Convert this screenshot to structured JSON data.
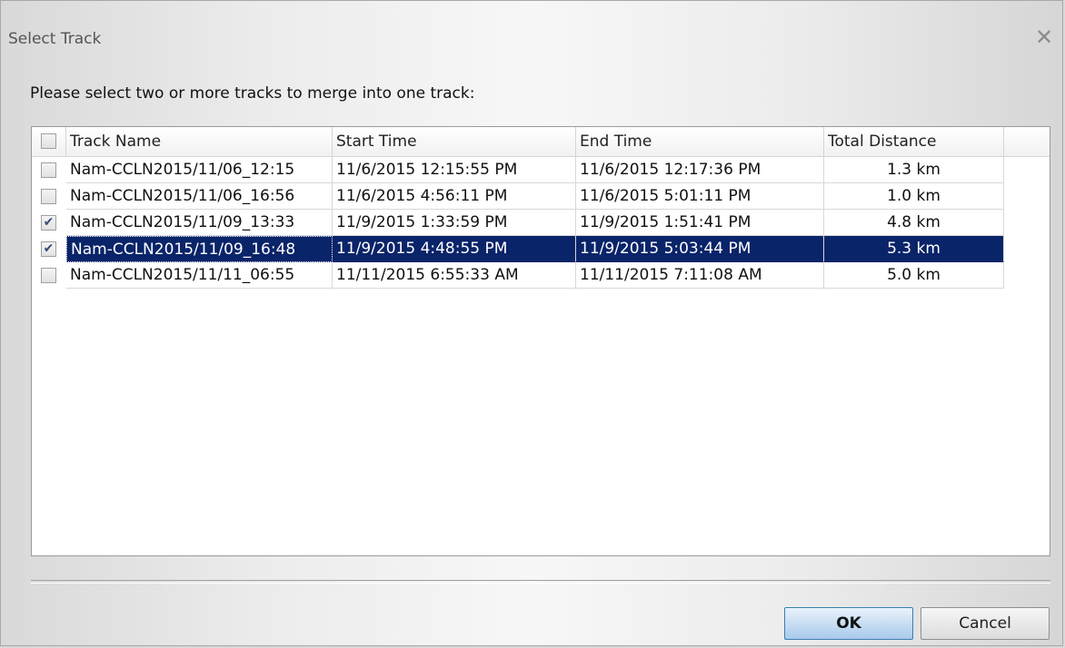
{
  "window": {
    "title": "Select Track",
    "close_glyph": "✕"
  },
  "prompt": "Please select two or more tracks to merge into one track:",
  "table": {
    "columns": [
      "Track Name",
      "Start Time",
      "End Time",
      "Total Distance"
    ],
    "rows": [
      {
        "checked": false,
        "selected": false,
        "name": "Nam-CCLN2015/11/06_12:15",
        "start": "11/6/2015 12:15:55 PM",
        "end": "11/6/2015 12:17:36 PM",
        "distance": "1.3 km"
      },
      {
        "checked": false,
        "selected": false,
        "name": "Nam-CCLN2015/11/06_16:56",
        "start": "11/6/2015 4:56:11 PM",
        "end": "11/6/2015 5:01:11 PM",
        "distance": "1.0 km"
      },
      {
        "checked": true,
        "selected": false,
        "name": "Nam-CCLN2015/11/09_13:33",
        "start": "11/9/2015 1:33:59 PM",
        "end": "11/9/2015 1:51:41 PM",
        "distance": "4.8 km"
      },
      {
        "checked": true,
        "selected": true,
        "name": "Nam-CCLN2015/11/09_16:48",
        "start": "11/9/2015 4:48:55 PM",
        "end": "11/9/2015 5:03:44 PM",
        "distance": "5.3 km"
      },
      {
        "checked": false,
        "selected": false,
        "name": "Nam-CCLN2015/11/11_06:55",
        "start": "11/11/2015 6:55:33 AM",
        "end": "11/11/2015 7:11:08 AM",
        "distance": "5.0 km"
      }
    ]
  },
  "buttons": {
    "ok": "OK",
    "cancel": "Cancel"
  },
  "colors": {
    "selection": "#0a246a",
    "ok_button": "#a9c9ea"
  }
}
